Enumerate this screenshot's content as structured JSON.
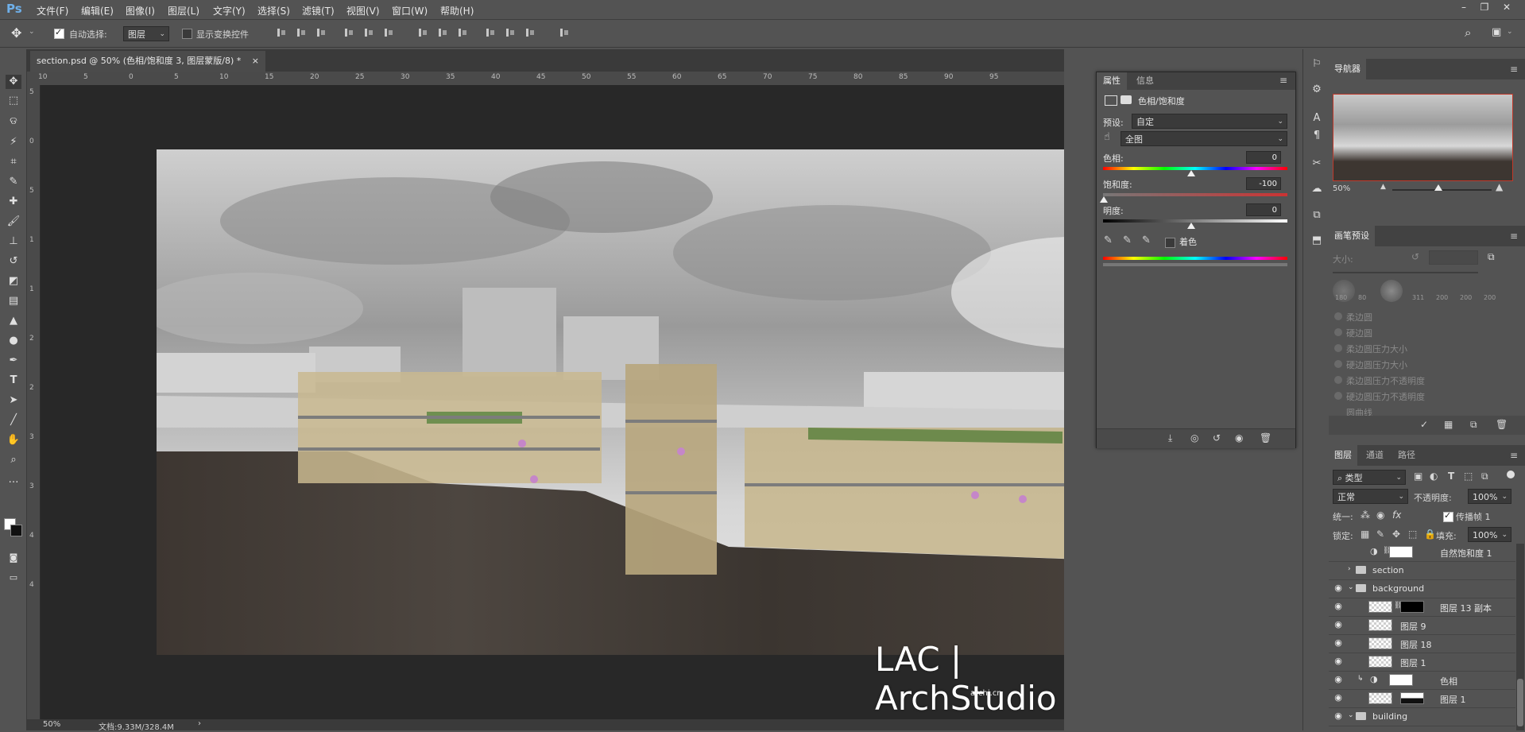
{
  "app": {
    "logo": "Ps"
  },
  "menu": [
    "文件(F)",
    "编辑(E)",
    "图像(I)",
    "图层(L)",
    "文字(Y)",
    "选择(S)",
    "滤镜(T)",
    "视图(V)",
    "窗口(W)",
    "帮助(H)"
  ],
  "window_controls": [
    "–",
    "❐",
    "✕"
  ],
  "options": {
    "auto_select_label": "自动选择:",
    "auto_select_checked": true,
    "auto_select_target": "图层",
    "show_transform_label": "显示变换控件",
    "show_transform_checked": false
  },
  "document_tab": {
    "title": "section.psd @ 50% (色相/饱和度 3, 图层蒙版/8) *",
    "close": "×"
  },
  "rulers": {
    "h_ticks": [
      "10",
      "5",
      "0",
      "5",
      "10",
      "15",
      "20",
      "25",
      "30",
      "35",
      "40",
      "45",
      "50",
      "55",
      "60",
      "65",
      "70",
      "75",
      "80",
      "85",
      "90",
      "95"
    ],
    "v_ticks": [
      "5",
      "0",
      "5",
      "1",
      "1",
      "2",
      "2",
      "3",
      "3",
      "4",
      "4"
    ]
  },
  "status": {
    "zoom": "50%",
    "doc_info": "文档:9.33M/328.4M"
  },
  "properties": {
    "tabs": [
      "属性",
      "信息"
    ],
    "title": "色相/饱和度",
    "preset_label": "预设:",
    "preset_value": "自定",
    "channel_value": "全图",
    "hue_label": "色相:",
    "hue_value": "0",
    "saturation_label": "饱和度:",
    "saturation_value": "-100",
    "lightness_label": "明度:",
    "lightness_value": "0",
    "colorize_label": "着色",
    "colorize_checked": false
  },
  "navigator": {
    "tab": "导航器",
    "zoom": "50%"
  },
  "brush_presets": {
    "tab": "画笔预设",
    "size_label": "大小:",
    "tip_sizes": [
      "180",
      "80",
      "",
      "311",
      "200",
      "200",
      "200"
    ],
    "items": [
      "柔边圆",
      "硬边圆",
      "柔边圆压力大小",
      "硬边圆压力大小",
      "柔边圆压力不透明度",
      "硬边圆压力不透明度",
      "圆曲线"
    ]
  },
  "layers": {
    "tabs": [
      "图层",
      "通道",
      "路径"
    ],
    "filter_kind": "类型",
    "blend_mode": "正常",
    "opacity_label": "不透明度:",
    "opacity_value": "100%",
    "unify_label": "统一:",
    "propagate_label": "传播帧 1",
    "lock_label": "锁定:",
    "fill_label": "填充:",
    "fill_value": "100%",
    "rows": [
      {
        "name": "自然饱和度 1",
        "visible": false,
        "type": "adjust"
      },
      {
        "name": "section",
        "visible": false,
        "type": "folder"
      },
      {
        "name": "background",
        "visible": true,
        "type": "folder-open"
      },
      {
        "name": "图层 13 副本",
        "visible": true,
        "type": "masked"
      },
      {
        "name": "图层 9",
        "visible": true,
        "type": "layer"
      },
      {
        "name": "图层 18",
        "visible": true,
        "type": "layer"
      },
      {
        "name": "图层 1",
        "visible": true,
        "type": "layer"
      },
      {
        "name": "色相",
        "visible": true,
        "type": "adjust-clip"
      },
      {
        "name": "图层 1",
        "visible": true,
        "type": "layer-masked"
      },
      {
        "name": "building",
        "visible": true,
        "type": "folder-open"
      }
    ]
  },
  "watermark": {
    "text": "LAC | ArchStudio",
    "sub": "archi.cn"
  }
}
